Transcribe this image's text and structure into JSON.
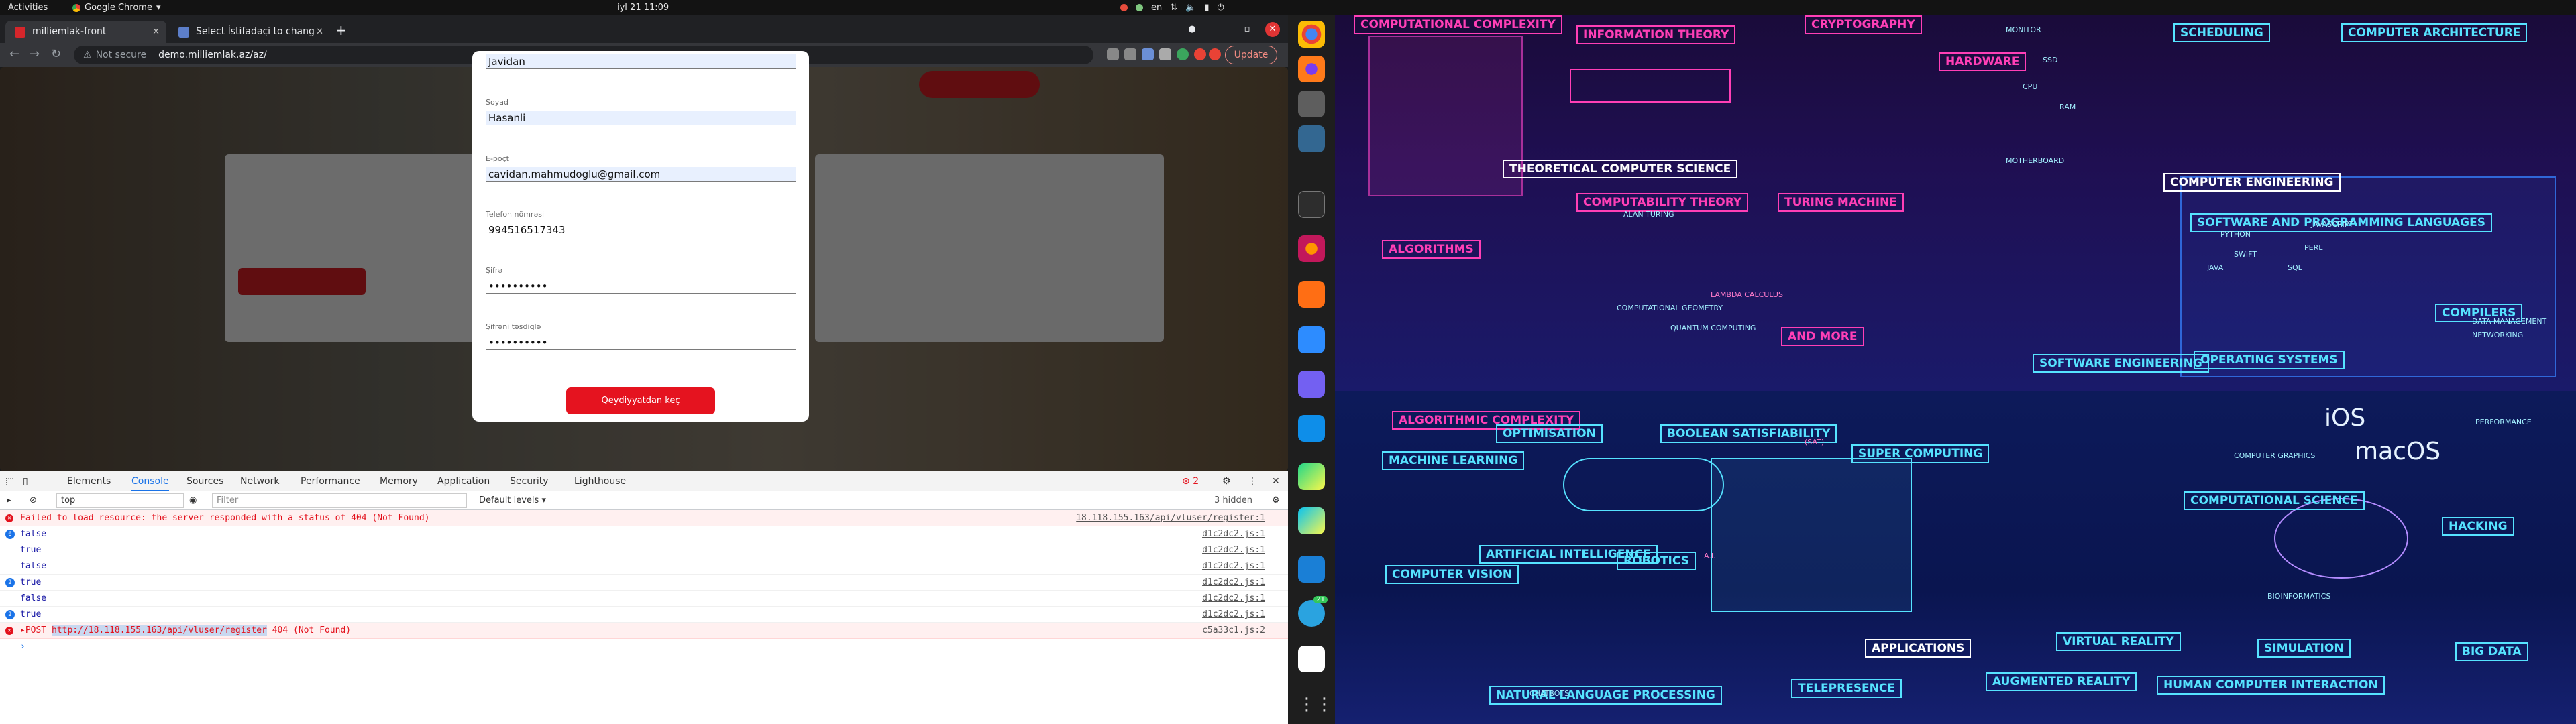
{
  "topbar": {
    "activities": "Activities",
    "app_name": "Google Chrome",
    "clock": "iyl 21  11:09",
    "lang": "en"
  },
  "browser": {
    "tabs": [
      {
        "title": "milliemlak-front"
      },
      {
        "title": "Select İstifadəçi to chang"
      }
    ],
    "not_secure": "Not secure",
    "url": "demo.milliemlak.az/az/",
    "update_label": "Update"
  },
  "form": {
    "fields": [
      {
        "label": "",
        "value": "Javidan"
      },
      {
        "label": "Soyad",
        "value": "Hasanli"
      },
      {
        "label": "E-poçt",
        "value": "cavidan.mahmudoglu@gmail.com"
      },
      {
        "label": "Telefon nömrəsi",
        "value": "994516517343"
      },
      {
        "label": "Şifrə",
        "value": "••••••••••"
      },
      {
        "label": "Şifrəni təsdiqlə",
        "value": "••••••••••"
      }
    ],
    "submit_label": "Qeydiyyatdan keç"
  },
  "devtools": {
    "tabs": [
      "Elements",
      "Console",
      "Sources",
      "Network",
      "Performance",
      "Memory",
      "Application",
      "Security",
      "Lighthouse"
    ],
    "active_tab": "Console",
    "error_count": "2",
    "context": "top",
    "filter_placeholder": "Filter",
    "levels": "Default levels",
    "hidden": "3 hidden",
    "log": [
      {
        "text": "Failed to load resource: the server responded with a status of 404 (Not Found)",
        "src": "18.118.155.163/api/vluser/register:1",
        "type": "error"
      },
      {
        "count": "6",
        "text": "false",
        "src": "d1c2dc2.js:1"
      },
      {
        "text": "true",
        "src": "d1c2dc2.js:1"
      },
      {
        "text": "false",
        "src": "d1c2dc2.js:1"
      },
      {
        "count": "2",
        "text": "true",
        "src": "d1c2dc2.js:1"
      },
      {
        "text": "false",
        "src": "d1c2dc2.js:1"
      },
      {
        "count": "2",
        "text": "true",
        "src": "d1c2dc2.js:1"
      },
      {
        "prefix": "▸POST",
        "url": "http://18.118.155.163/api/vluser/register",
        "suffix": "404 (Not Found)",
        "src": "c5a33c1.js:2",
        "type": "error"
      }
    ]
  },
  "dock": [
    "chrome",
    "firefox",
    "files",
    "postgres",
    "terminal",
    "firefox-dev",
    "sublime",
    "zoom",
    "viber",
    "teamviewer",
    "pycharm",
    "webstorm",
    "vscode",
    "telegram",
    "slack",
    "app-grid"
  ],
  "dock_badge": "21",
  "wallpaper": {
    "labels": [
      "COMPUTATIONAL COMPLEXITY",
      "INFORMATION THEORY",
      "CRYPTOGRAPHY",
      "HARDWARE",
      "SCHEDULING",
      "COMPUTER ARCHITECTURE",
      "THEORETICAL COMPUTER SCIENCE",
      "COMPUTABILITY THEORY",
      "TURING MACHINE",
      "COMPUTER ENGINEERING",
      "SOFTWARE AND PROGRAMMING LANGUAGES",
      "ALGORITHMS",
      "ALGORITHMIC COMPLEXITY",
      "AND MORE",
      "SOFTWARE ENGINEERING",
      "OPERATING SYSTEMS",
      "COMPILERS",
      "OPTIMISATION",
      "BOOLEAN SATISFIABILITY",
      "SUPER COMPUTING",
      "COMPUTATIONAL SCIENCE",
      "MACHINE LEARNING",
      "ARTIFICIAL INTELLIGENCE",
      "ROBOTICS",
      "COMPUTER VISION",
      "APPLICATIONS",
      "VIRTUAL REALITY",
      "SIMULATION",
      "NATURAL LANGUAGE PROCESSING",
      "TELEPRESENCE",
      "AUGMENTED REALITY",
      "HUMAN COMPUTER INTERACTION",
      "HACKING",
      "BIG DATA"
    ],
    "small_texts": [
      "MONITOR",
      "SSD",
      "CPU",
      "RAM",
      "MOTHERBOARD",
      "PYTHON",
      "JAVASCRIPT",
      "SWIFT",
      "PERL",
      "JAVA",
      "SQL",
      "iOS",
      "macOS",
      "A.I.",
      "(SAT)",
      "ALAN TURING",
      "LAMBDA CALCULUS",
      "CHATBOTS",
      "DATA MANAGEMENT",
      "NETWORKING",
      "PERFORMANCE",
      "COMPUTER GRAPHICS",
      "BIOINFORMATICS",
      "QUANTUM COMPUTING",
      "COMPUTATIONAL GEOMETRY"
    ]
  }
}
